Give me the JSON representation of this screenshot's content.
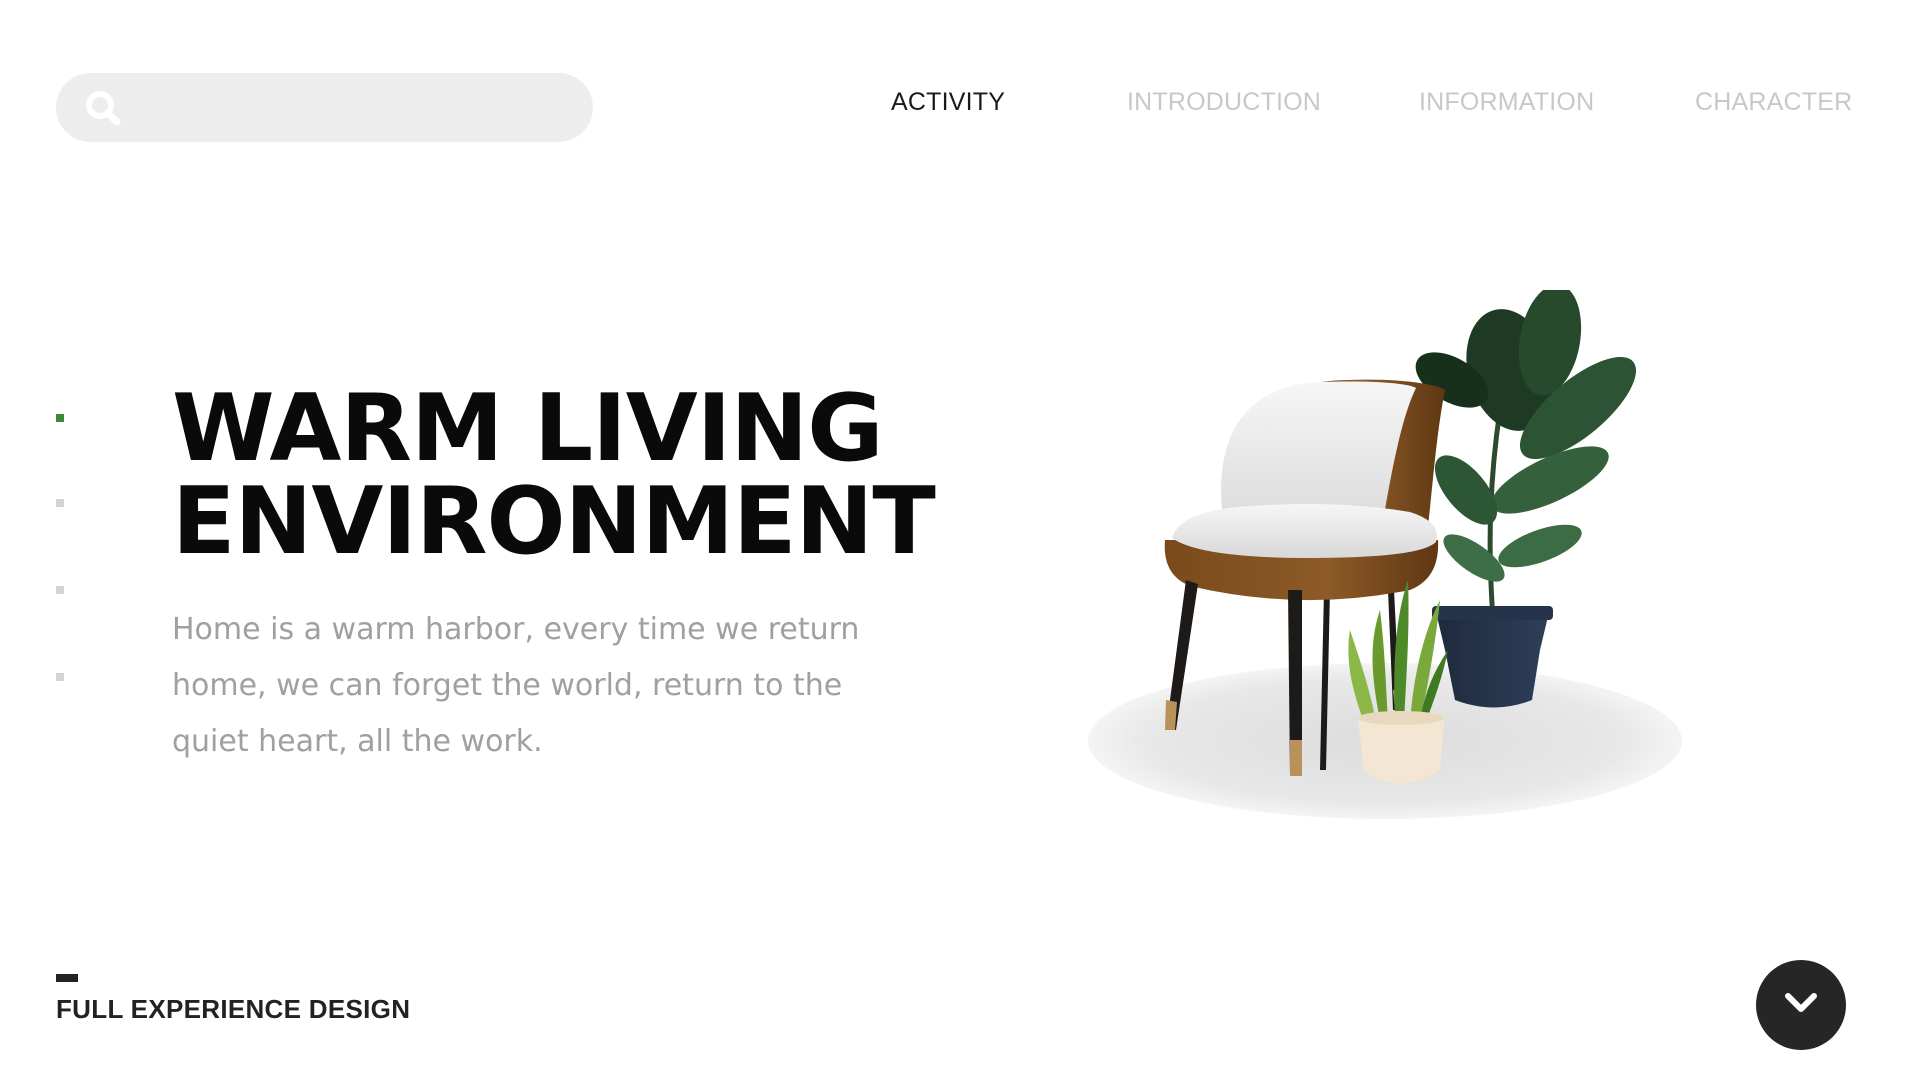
{
  "search": {
    "placeholder": "",
    "value": "",
    "icon": "search-icon"
  },
  "nav": {
    "items": [
      {
        "label": "ACTIVITY",
        "active": true
      },
      {
        "label": "INTRODUCTION",
        "active": false
      },
      {
        "label": "INFORMATION",
        "active": false
      },
      {
        "label": "CHARACTER",
        "active": false
      }
    ]
  },
  "pager": {
    "count": 4,
    "active_index": 0
  },
  "hero": {
    "title_line1": "WARM LIVING",
    "title_line2": "ENVIRONMENT",
    "description": "Home is a warm harbor, every time we return home, we can forget the world, return to the quiet heart, all the work."
  },
  "footer": {
    "label": "FULL EXPERIENCE DESIGN",
    "scroll_icon": "chevron-down-icon"
  },
  "colors": {
    "active_nav": "#1a1a1a",
    "inactive_nav": "#c8c8c8",
    "pager_active": "#3a8a3a",
    "pager_inactive": "#d4d4d4",
    "button_bg": "#262626",
    "search_bg": "#ededed"
  }
}
